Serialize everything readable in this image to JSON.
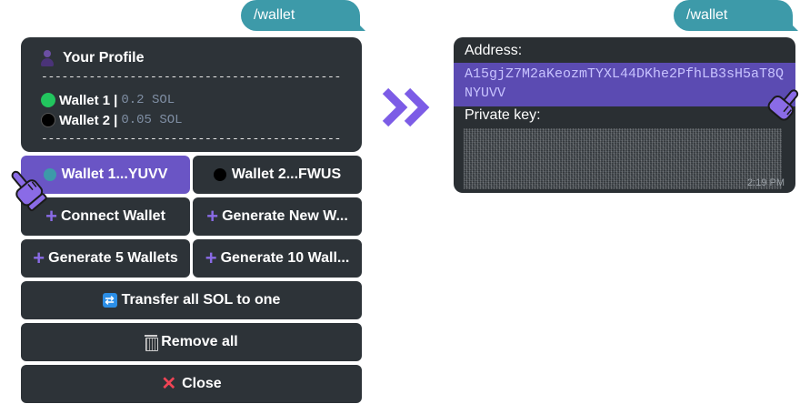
{
  "left_panel": {
    "command": "/wallet",
    "profile": {
      "title": "Your Profile",
      "divider": "------------------------------------------------",
      "wallets": [
        {
          "label": "Wallet 1",
          "separator": "|",
          "balance": "0.2 SOL",
          "color": "#22c55e"
        },
        {
          "label": "Wallet 2",
          "separator": "|",
          "balance": "0.05 SOL",
          "color": "#000000"
        }
      ]
    },
    "buttons": {
      "wallet1": "Wallet 1...YUVV",
      "wallet2": "Wallet 2...FWUS",
      "connect": "Connect Wallet",
      "generate_new": "Generate New W...",
      "generate_5": "Generate 5 Wallets",
      "generate_10": "Generate 10 Wall...",
      "transfer_all": "Transfer all SOL to one",
      "remove_all": "Remove all",
      "close": "Close"
    }
  },
  "right_panel": {
    "command": "/wallet",
    "address_label": "Address:",
    "address_value": "A15gjZ7M2aKeozmTYXL44DKhe2PfhLB3sH5aT8QNYUVV",
    "private_key_label": "Private key:",
    "timestamp": "2:19 PM"
  },
  "colors": {
    "accent": "#6a55c5",
    "command_bubble": "#3d9aa9",
    "card": "#2d3338",
    "address_highlight": "#5b4bb2"
  }
}
